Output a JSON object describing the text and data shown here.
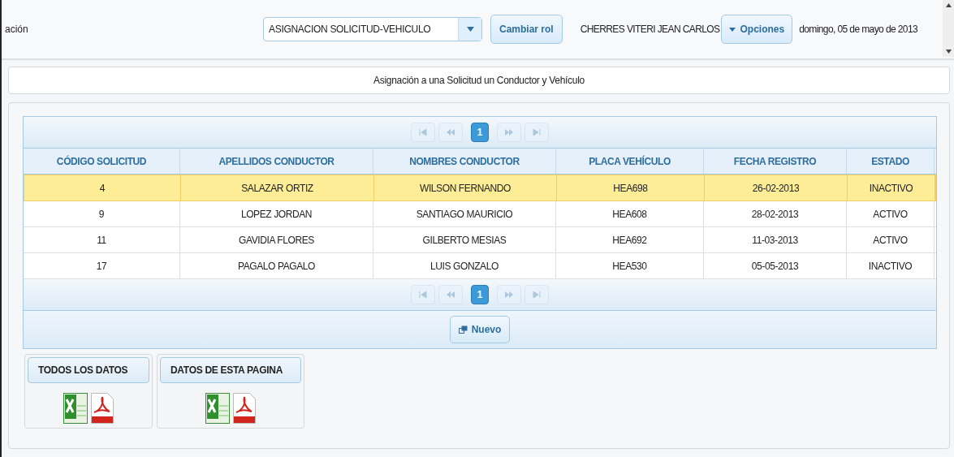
{
  "header": {
    "module_title": "ación",
    "role_select": {
      "value": "ASIGNACION SOLICITUD-VEHICULO"
    },
    "change_role_button": "Cambiar rol",
    "user_name": "CHERRES VITERI JEAN CARLOS",
    "options_button": "Opciones",
    "date": "domingo, 05 de mayo de 2013"
  },
  "page_title": "Asignación a una Solicitud un Conductor y Vehículo",
  "table": {
    "top_paginator": {
      "nav_disabled": true,
      "pages": [
        {
          "label": "1",
          "selected": true
        }
      ]
    },
    "columns": [
      "CÓDIGO SOLICITUD",
      "APELLIDOS CONDUCTOR",
      "NOMBRES CONDUCTOR",
      "PLACA VEHÍCULO",
      "FECHA REGISTRO",
      "ESTADO"
    ],
    "rows": [
      {
        "selected": true,
        "cells": [
          "4",
          "SALAZAR ORTIZ",
          "WILSON FERNANDO",
          "HEA698",
          "26-02-2013",
          "INACTIVO"
        ]
      },
      {
        "selected": false,
        "cells": [
          "9",
          "LOPEZ JORDAN",
          "SANTIAGO MAURICIO",
          "HEA608",
          "28-02-2013",
          "ACTIVO"
        ]
      },
      {
        "selected": false,
        "cells": [
          "11",
          "GAVIDIA FLORES",
          "GILBERTO MESIAS",
          "HEA692",
          "11-03-2013",
          "ACTIVO"
        ]
      },
      {
        "selected": false,
        "cells": [
          "17",
          "PAGALO PAGALO",
          "LUIS GONZALO",
          "HEA530",
          "05-05-2013",
          "INACTIVO"
        ]
      }
    ],
    "bottom_paginator": {
      "nav_disabled": true,
      "pages": [
        {
          "label": "1",
          "selected": true
        }
      ]
    },
    "new_button": "Nuevo"
  },
  "exports": [
    {
      "title": "TODOS LOS DATOS"
    },
    {
      "title": "DATOS DE ESTA PAGINA"
    }
  ]
}
